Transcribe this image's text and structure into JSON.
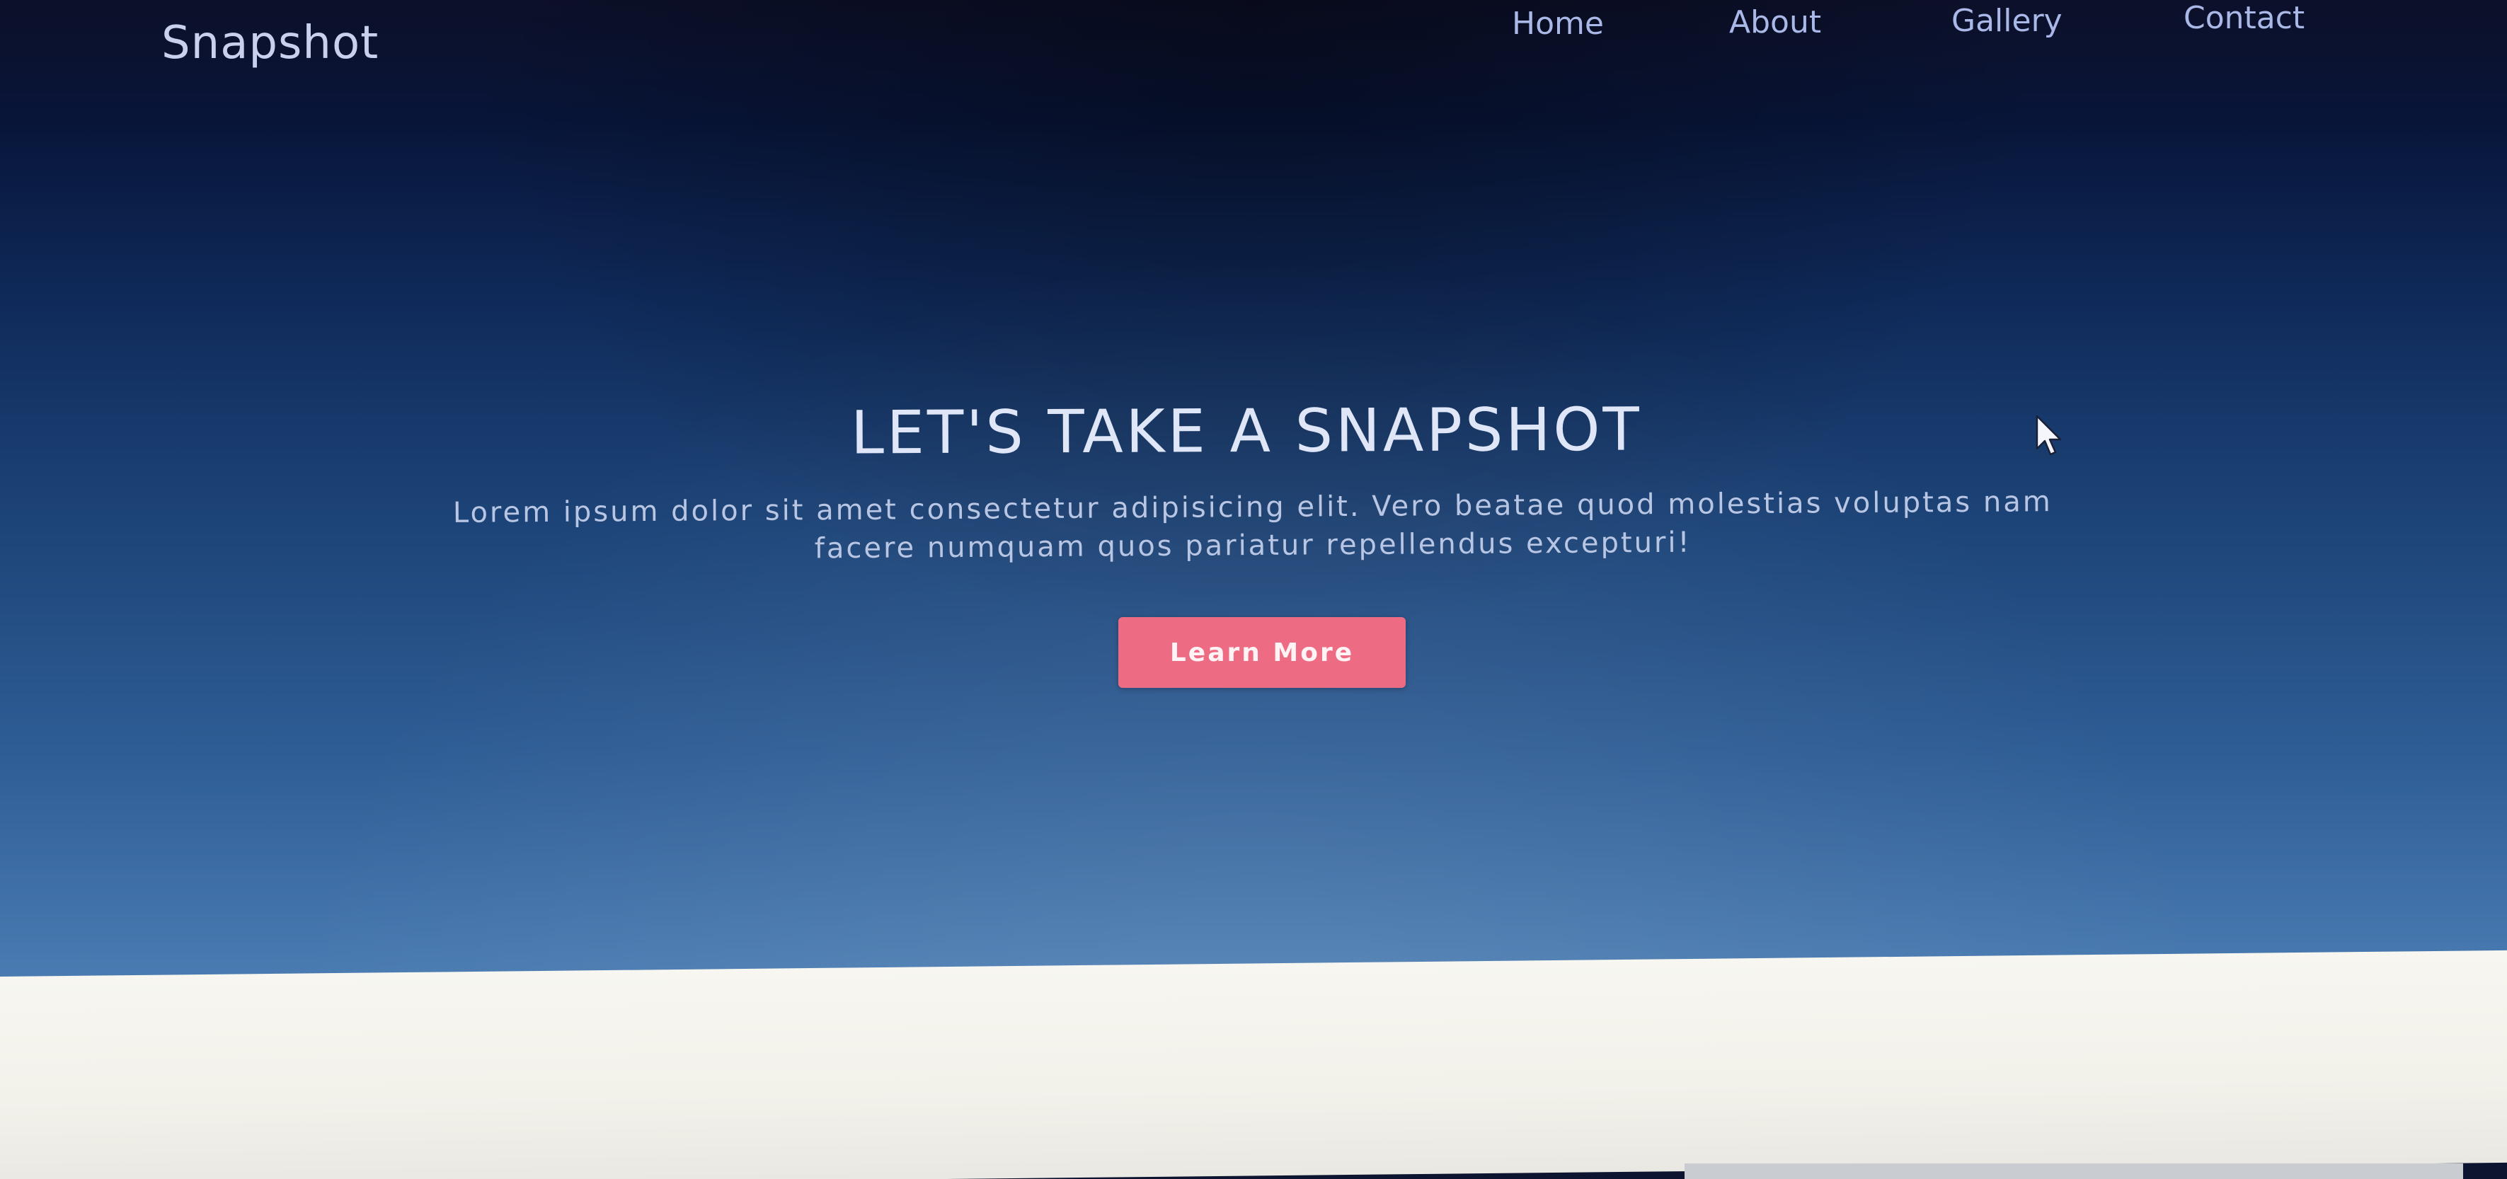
{
  "header": {
    "brand": "Snapshot",
    "nav": [
      "Home",
      "About",
      "Gallery",
      "Contact"
    ]
  },
  "hero": {
    "title": "LET'S TAKE A SNAPSHOT",
    "subtitle_line1": "Lorem ipsum dolor sit amet consectetur adipisicing elit. Vero beatae quod molestias voluptas nam",
    "subtitle_line2": "facere numquam quos pariatur repellendus excepturi!",
    "button_label": "Learn More"
  },
  "colors": {
    "hero_top": "#0c1029",
    "hero_bottom": "#4d7fb5",
    "accent_button": "#ee6b84",
    "below_section": "#f7f6f0"
  },
  "icons": {
    "cursor": "mouse-pointer-icon"
  }
}
